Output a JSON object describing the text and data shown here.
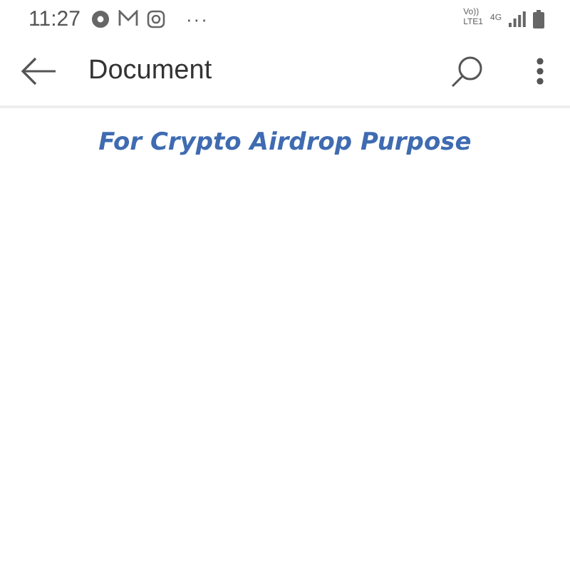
{
  "status_bar": {
    "time": "11:27",
    "more": "···",
    "network": {
      "voice": "Vo))",
      "lte": "LTE1",
      "generation": "4G"
    }
  },
  "toolbar": {
    "title": "Document"
  },
  "document": {
    "heading": "For Crypto Airdrop Purpose"
  }
}
